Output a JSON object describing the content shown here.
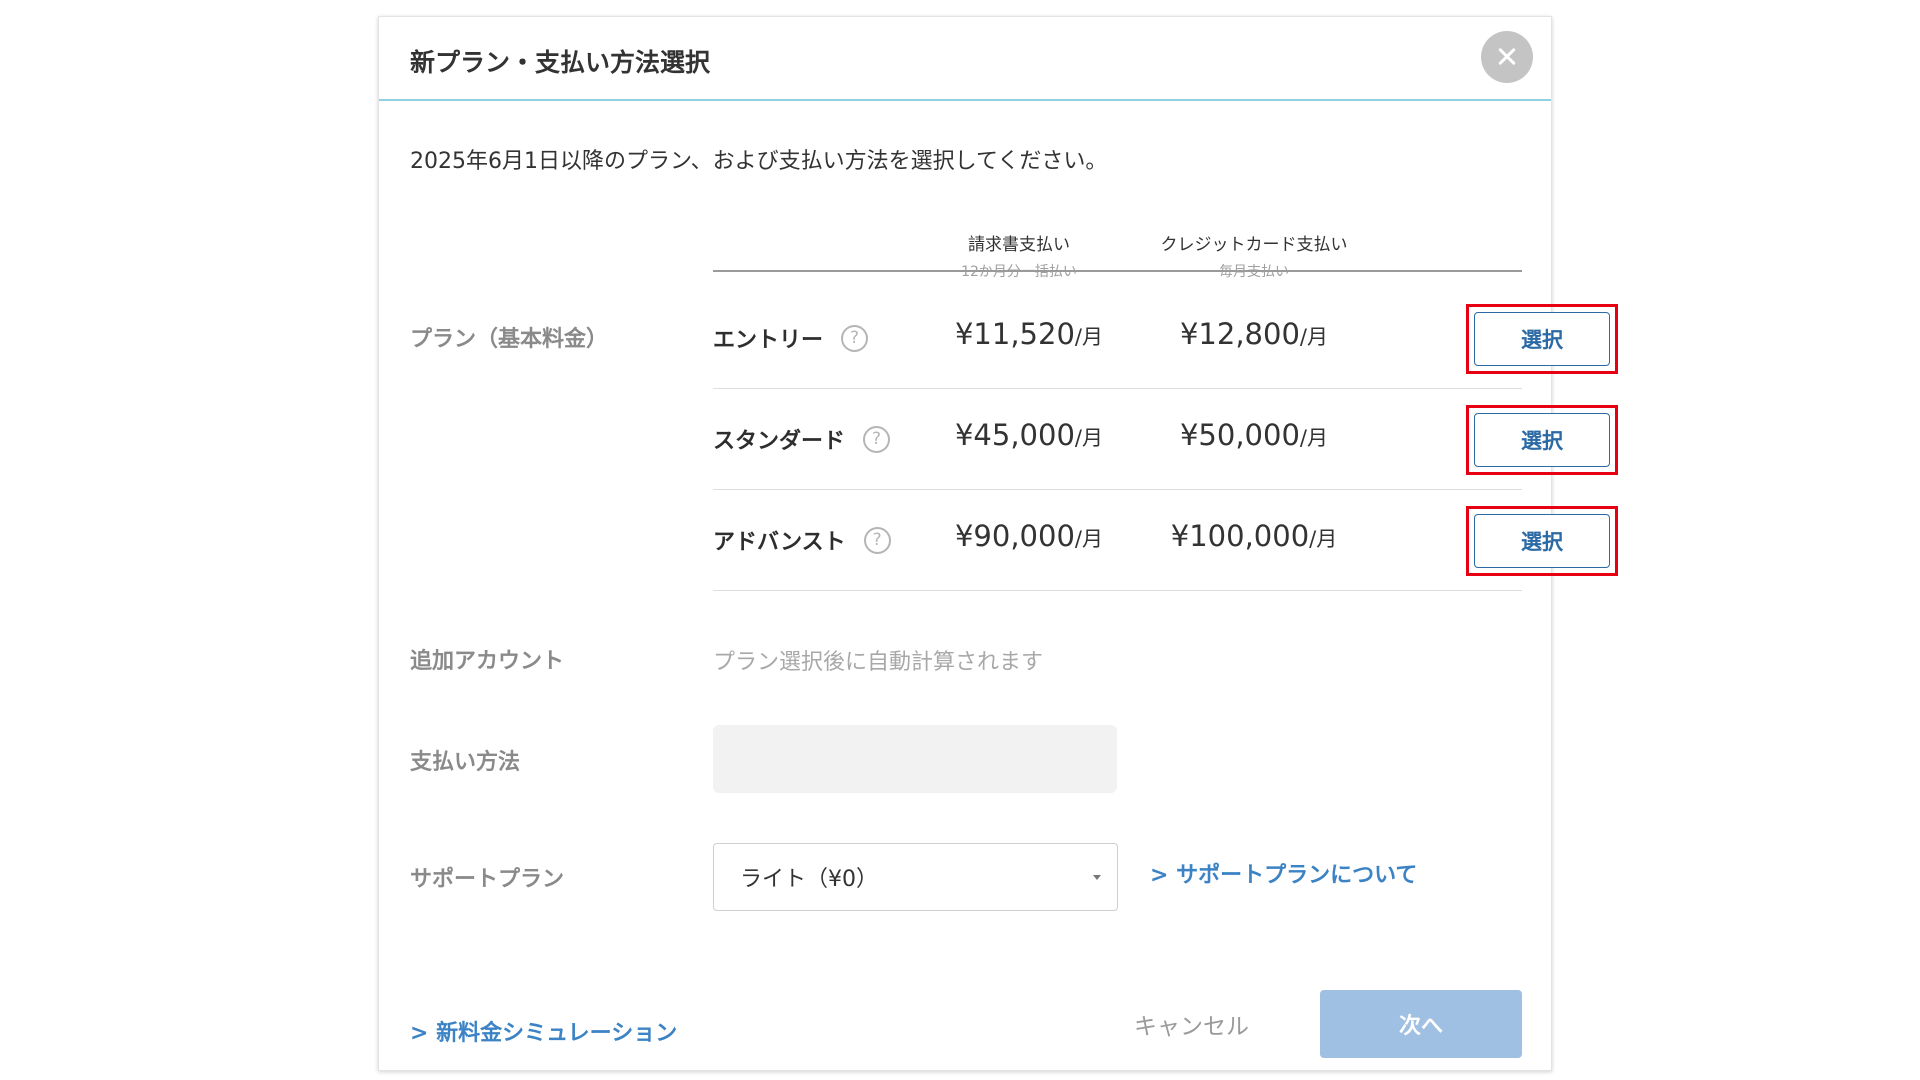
{
  "modal": {
    "title": "新プラン・支払い方法選択",
    "close_icon": "close-icon",
    "intro": "2025年6月1日以降のプラン、および支払い方法を選択してください。"
  },
  "columns": {
    "invoice": {
      "label": "請求書支払い",
      "sub": "12か月分一括払い"
    },
    "credit": {
      "label": "クレジットカード支払い",
      "sub": "毎月支払い"
    }
  },
  "labels": {
    "plan": "プラン（基本料金）",
    "additional_account": "追加アカウント",
    "payment_method": "支払い方法",
    "support_plan": "サポートプラン"
  },
  "plans": [
    {
      "name": "エントリー",
      "invoice_price": "¥11,520",
      "credit_price": "¥12,800",
      "unit": "/月",
      "select_label": "選択"
    },
    {
      "name": "スタンダード",
      "invoice_price": "¥45,000",
      "credit_price": "¥50,000",
      "unit": "/月",
      "select_label": "選択"
    },
    {
      "name": "アドバンスト",
      "invoice_price": "¥90,000",
      "credit_price": "¥100,000",
      "unit": "/月",
      "select_label": "選択"
    }
  ],
  "help_glyph": "?",
  "additional_account_text": "プラン選択後に自動計算されます",
  "payment_method_value": "",
  "support": {
    "selected": "ライト（¥0）",
    "link": "> サポートプランについて"
  },
  "footer": {
    "simulation_link": "> 新料金シミュレーション",
    "cancel": "キャンセル",
    "next": "次へ"
  },
  "colors": {
    "accent": "#3b83c5",
    "highlight": "#e60012",
    "next_button": "#9fc0e2",
    "header_rule": "#8fd0e4"
  }
}
